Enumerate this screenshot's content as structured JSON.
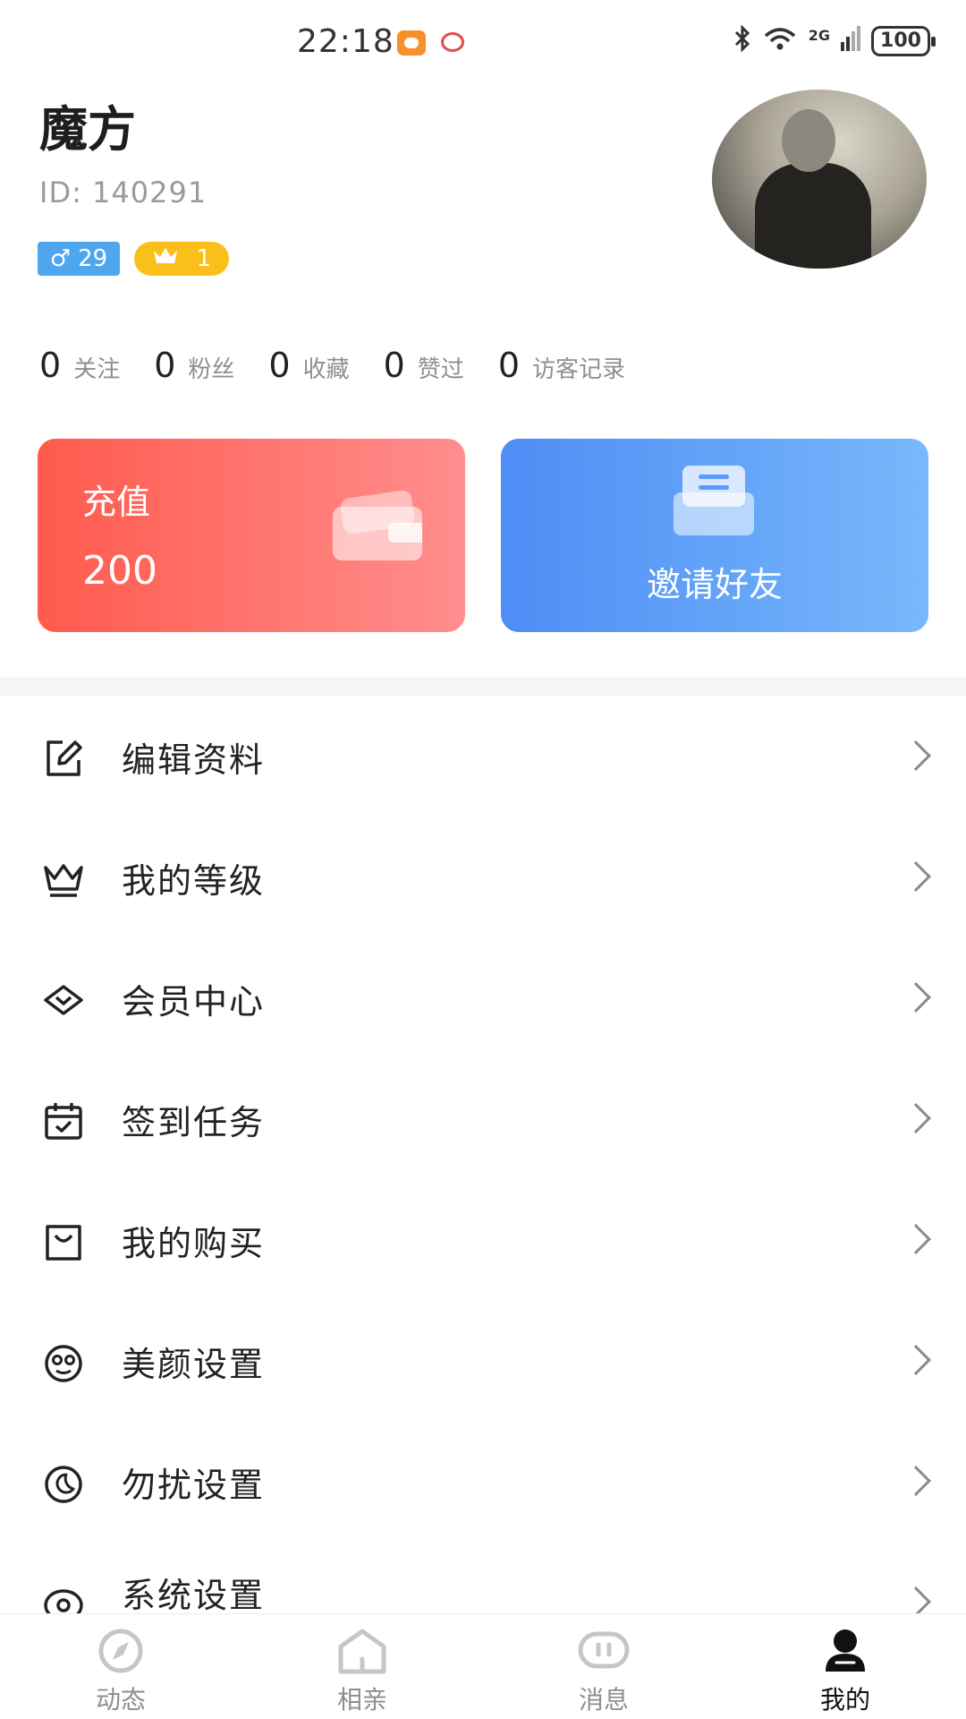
{
  "status_bar": {
    "time": "22:18",
    "network": "2G",
    "battery": "100"
  },
  "profile": {
    "name": "魔方",
    "id_text": "ID: 140291",
    "gender_symbol": "♂",
    "age": "29",
    "level": "1"
  },
  "stats": [
    {
      "count": "0",
      "label": "关注"
    },
    {
      "count": "0",
      "label": "粉丝"
    },
    {
      "count": "0",
      "label": "收藏"
    },
    {
      "count": "0",
      "label": "赞过"
    },
    {
      "count": "0",
      "label": "访客记录"
    }
  ],
  "cards": {
    "recharge": {
      "title": "充值",
      "amount": "200"
    },
    "invite": {
      "label": "邀请好友"
    }
  },
  "menu": [
    {
      "label": "编辑资料",
      "icon": "edit-icon"
    },
    {
      "label": "我的等级",
      "icon": "crown-icon"
    },
    {
      "label": "会员中心",
      "icon": "diamond-icon"
    },
    {
      "label": "签到任务",
      "icon": "calendar-check-icon"
    },
    {
      "label": "我的购买",
      "icon": "shopping-bag-icon"
    },
    {
      "label": "美颜设置",
      "icon": "face-icon"
    },
    {
      "label": "勿扰设置",
      "icon": "moon-icon"
    },
    {
      "label": "系统设置",
      "icon": "eye-icon"
    }
  ],
  "tabs": [
    {
      "label": "动态",
      "icon": "compass-icon",
      "active": false
    },
    {
      "label": "相亲",
      "icon": "home-icon",
      "active": false
    },
    {
      "label": "消息",
      "icon": "chat-icon",
      "active": false
    },
    {
      "label": "我的",
      "icon": "person-icon",
      "active": true
    }
  ],
  "colors": {
    "recharge_start": "#ff5a4d",
    "recharge_end": "#ff8e8e",
    "invite_start": "#4d8df5",
    "invite_end": "#78b8fb",
    "gender_badge": "#4ea6ee",
    "level_badge": "#fbbf1b"
  }
}
